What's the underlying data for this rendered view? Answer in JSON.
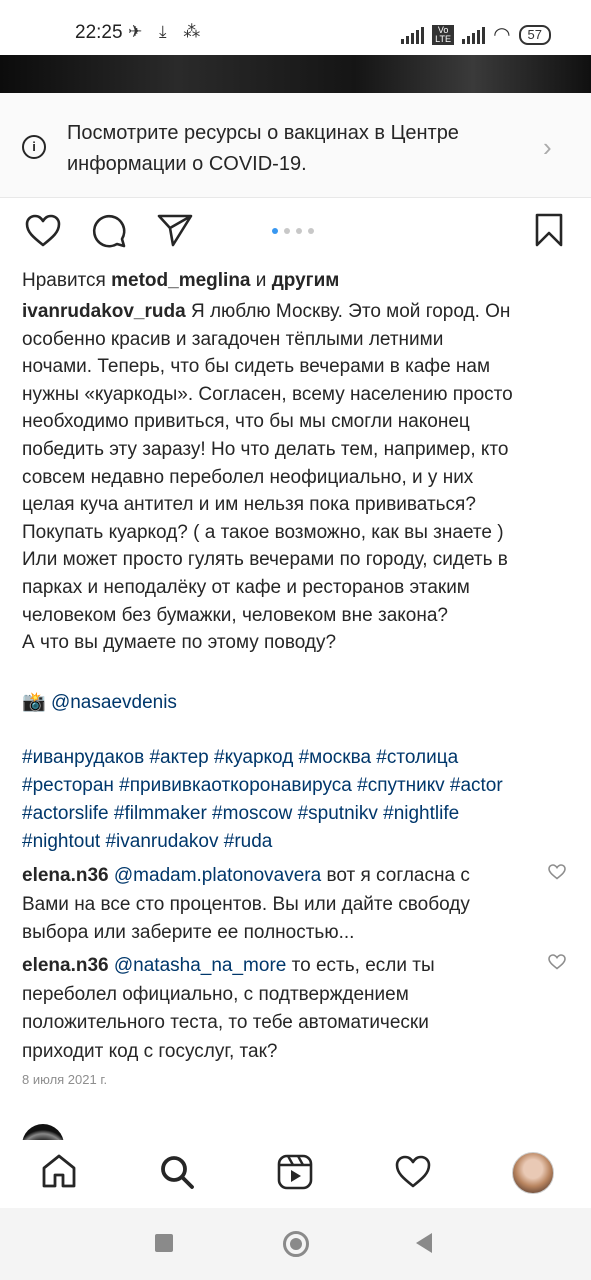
{
  "status_bar": {
    "time": "22:25",
    "left_icons": "✈ ⤓ ⁂",
    "lte_badge": "Vo LTE",
    "battery": "57"
  },
  "covid_banner": {
    "text": "Посмотрите ресурсы о вакцинах в Центре информации о COVID-19."
  },
  "carousel": {
    "count": 4,
    "active_index": 0,
    "accent": "#3897f0"
  },
  "likes": {
    "prefix": "Нравится",
    "user": "metod_meglina",
    "connector": "и",
    "others": "другим"
  },
  "post": {
    "author": "ivanrudakov_ruda",
    "caption": "Я люблю Москву. Это мой город. Он\nособенно красив и загадочен тёплыми летними\nночами. Теперь, что бы сидеть вечерами в кафе нам\nнужны «куаркоды». Согласен, всему населению просто\nнеобходимо привиться, что бы мы смогли наконец\nпобедить эту заразу! Но что делать тем, например, кто\nсовсем недавно переболел неофициально, и у них\nцелая куча антител и им нельзя пока прививаться?\nПокупать куаркод? ( а такое возможно, как вы знаете )\nИли может просто гулять вечерами по городу, сидеть в\nпарках и неподалёку от кафе и ресторанов этаким\nчеловеком без бумажки, человеком вне закона?\nА что вы думаете по этому поводу?",
    "photo_credit_emoji": "📸",
    "photo_credit": "@nasaevdenis",
    "hashtag_lines": [
      "#иванрудаков #актер #куаркод #москва #столица",
      "#ресторан #прививкаоткоронавируса #спутникv #actor",
      "#actorslife #filmmaker #moscow #sputnikv #nightlife",
      "#nightout #ivanrudakov  #ruda"
    ]
  },
  "comments": [
    {
      "user": "elena.n36",
      "mention": "@madam.platonovavera",
      "first_line_rest": " вот я согласна с",
      "rest": "Вами на все сто процентов. Вы или дайте свободу\nвыбора или заберите ее полностью..."
    },
    {
      "user": "elena.n36",
      "mention": "@natasha_na_more",
      "first_line_rest": " то есть, если ты",
      "rest": "переболел официально, с подтверждением\nположительного теста, то тебе автоматически\nприходит код с госуслуг, так?"
    }
  ],
  "date": "8 июля 2021 г.",
  "nav_icons": [
    "home-icon",
    "search-icon",
    "reels-icon",
    "activity-heart-icon",
    "profile-avatar"
  ],
  "colors": {
    "link": "#00376b",
    "text": "#262626",
    "muted": "#8e8e8e"
  }
}
